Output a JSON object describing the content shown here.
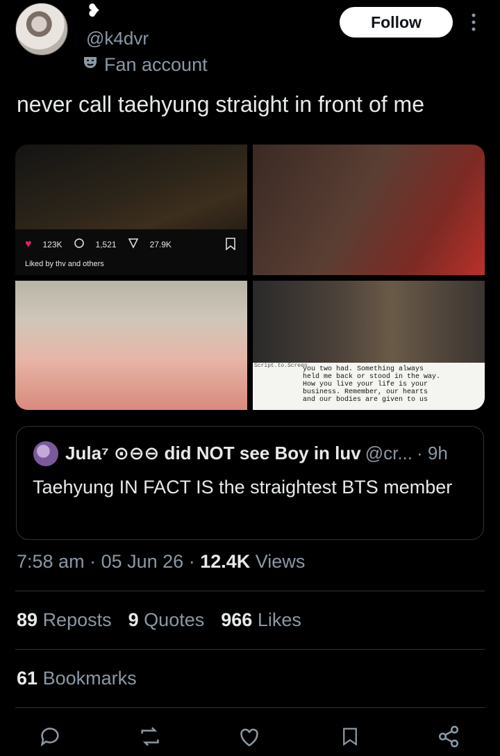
{
  "author": {
    "name_glyph": "❥",
    "handle": "@k4dvr",
    "badge_text": "Fan account"
  },
  "follow_label": "Follow",
  "tweet": {
    "text": "never call taehyung straight in front of me"
  },
  "media": {
    "tile1": {
      "likes": "123K",
      "comments": "1,521",
      "shares": "27.9K",
      "liked_by": "Liked by thv and others"
    },
    "tile4": {
      "caption": "you two had. Something always\nheld me back or stood in the way.\nHow you live your life is your\nbusiness. Remember, our hearts\nand our bodies are given to us",
      "watermark": "Script.to.Screen"
    }
  },
  "quote": {
    "name": "Jula⁷ ⊙⊖⊖ did NOT see Boy in luv",
    "handle": "@cr...",
    "time": "· 9h",
    "text": "Taehyung IN FACT IS the straightest BTS member"
  },
  "meta": {
    "time": "7:58 am",
    "date": "05 Jun 26",
    "views_count": "12.4K",
    "views_label": "Views"
  },
  "stats": {
    "reposts_count": "89",
    "reposts_label": "Reposts",
    "quotes_count": "9",
    "quotes_label": "Quotes",
    "likes_count": "966",
    "likes_label": "Likes",
    "bookmarks_count": "61",
    "bookmarks_label": "Bookmarks"
  },
  "icons": {
    "reply": "reply-icon",
    "repost": "repost-icon",
    "like": "heart-icon",
    "bookmark": "bookmark-icon",
    "share": "share-icon"
  },
  "colors": {
    "background": "#000000",
    "text": "#e7e9ea",
    "muted": "#8b98a5",
    "border": "#2f3336",
    "accent": "#1d9bf0"
  }
}
